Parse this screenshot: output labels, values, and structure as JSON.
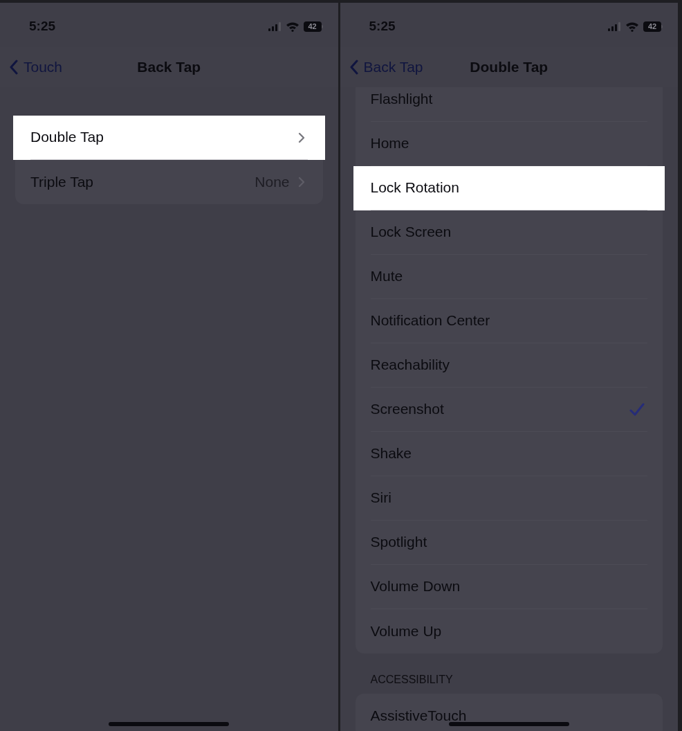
{
  "screens": [
    {
      "status_bar": {
        "time": "5:25",
        "battery": "42"
      },
      "nav": {
        "back": "Touch",
        "title": "Back Tap"
      },
      "groups": [
        {
          "rows": [
            {
              "label": "Double Tap",
              "highlighted": true
            },
            {
              "label": "Triple Tap",
              "value": "None",
              "highlighted": false
            }
          ]
        }
      ]
    },
    {
      "status_bar": {
        "time": "5:25",
        "battery": "42"
      },
      "nav": {
        "back": "Back Tap",
        "title": "Double Tap"
      },
      "groups": [
        {
          "rows": [
            {
              "label": "Flashlight",
              "highlighted": false,
              "checked": false
            },
            {
              "label": "Home",
              "highlighted": false,
              "checked": false
            },
            {
              "label": "Lock Rotation",
              "highlighted": true,
              "checked": false
            },
            {
              "label": "Lock Screen",
              "highlighted": false,
              "checked": false
            },
            {
              "label": "Mute",
              "highlighted": false,
              "checked": false
            },
            {
              "label": "Notification Center",
              "highlighted": false,
              "checked": false
            },
            {
              "label": "Reachability",
              "highlighted": false,
              "checked": false
            },
            {
              "label": "Screenshot",
              "highlighted": false,
              "checked": true
            },
            {
              "label": "Shake",
              "highlighted": false,
              "checked": false
            },
            {
              "label": "Siri",
              "highlighted": false,
              "checked": false
            },
            {
              "label": "Spotlight",
              "highlighted": false,
              "checked": false
            },
            {
              "label": "Volume Down",
              "highlighted": false,
              "checked": false
            },
            {
              "label": "Volume Up",
              "highlighted": false,
              "checked": false
            }
          ]
        },
        {
          "header": "ACCESSIBILITY",
          "rows": [
            {
              "label": "AssistiveTouch",
              "highlighted": false,
              "checked": false
            }
          ]
        }
      ]
    }
  ]
}
